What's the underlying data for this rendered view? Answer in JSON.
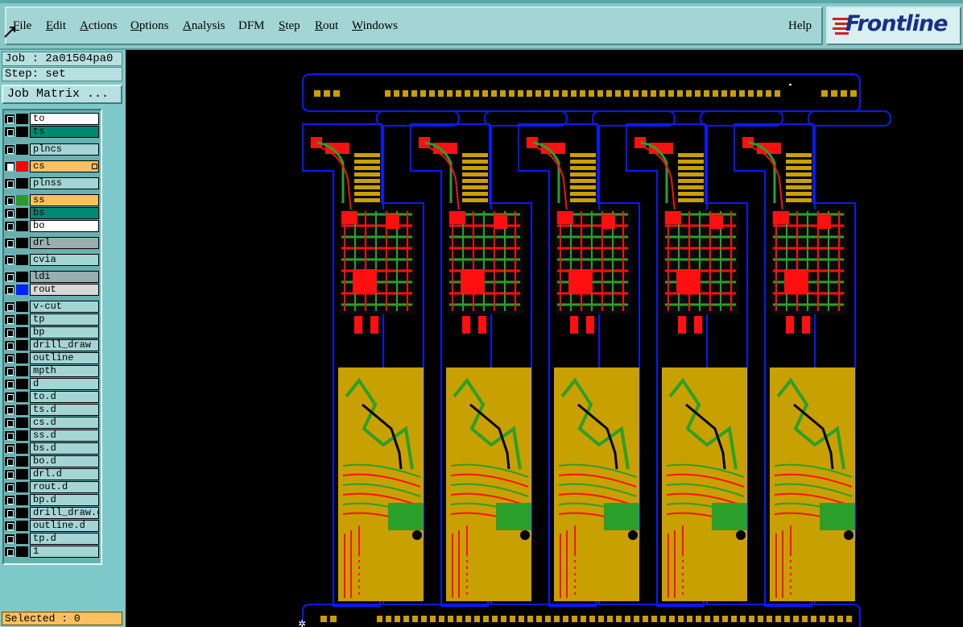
{
  "menubar": {
    "items": [
      {
        "label": "File"
      },
      {
        "label": "Edit"
      },
      {
        "label": "Actions"
      },
      {
        "label": "Options"
      },
      {
        "label": "Analysis"
      },
      {
        "label": "DFM"
      },
      {
        "label": "Step"
      },
      {
        "label": "Rout"
      },
      {
        "label": "Windows"
      }
    ],
    "help_label": "Help",
    "logo_text": "Frontline"
  },
  "job_info": {
    "job_line": "Job : 2a01504pa0",
    "step_line": "Step: set",
    "job_matrix_label": "Job Matrix ..."
  },
  "layers": [
    {
      "name": "to",
      "bg": "#ffffff",
      "swatch": "#000000"
    },
    {
      "name": "ts",
      "bg": "#008870",
      "swatch": "#000000"
    },
    {
      "name": "plncs",
      "bg": "#a3d5d5",
      "swatch": "#000000"
    },
    {
      "name": "cs",
      "bg": "#f8c060",
      "swatch": "#ff0000",
      "checked": true,
      "mark": true
    },
    {
      "name": "plnss",
      "bg": "#a3d5d5",
      "swatch": "#000000"
    },
    {
      "name": "ss",
      "bg": "#f8c060",
      "swatch": "#2a9a2a"
    },
    {
      "name": "bs",
      "bg": "#008870",
      "swatch": "#000000"
    },
    {
      "name": "bo",
      "bg": "#ffffff",
      "swatch": "#000000"
    },
    {
      "name": "drl",
      "bg": "#9aaeb0",
      "swatch": "#000000"
    },
    {
      "name": "cvia",
      "bg": "#a3d5d5",
      "swatch": "#000000"
    },
    {
      "name": "ldi",
      "bg": "#9aaeb0",
      "swatch": "#000000"
    },
    {
      "name": "rout",
      "bg": "#d8d8d8",
      "swatch": "#0022ff"
    },
    {
      "name": "v-cut",
      "bg": "#a3d5d5",
      "swatch": "#000000"
    },
    {
      "name": "tp",
      "bg": "#a3d5d5",
      "swatch": "#000000"
    },
    {
      "name": "bp",
      "bg": "#a3d5d5",
      "swatch": "#000000"
    },
    {
      "name": "drill_draw",
      "bg": "#a3d5d5",
      "swatch": "#000000"
    },
    {
      "name": "outline",
      "bg": "#a3d5d5",
      "swatch": "#000000"
    },
    {
      "name": "mpth",
      "bg": "#a3d5d5",
      "swatch": "#000000"
    },
    {
      "name": "d",
      "bg": "#a3d5d5",
      "swatch": "#000000"
    },
    {
      "name": "to.d",
      "bg": "#a3d5d5",
      "swatch": "#000000"
    },
    {
      "name": "ts.d",
      "bg": "#a3d5d5",
      "swatch": "#000000"
    },
    {
      "name": "cs.d",
      "bg": "#a3d5d5",
      "swatch": "#000000"
    },
    {
      "name": "ss.d",
      "bg": "#a3d5d5",
      "swatch": "#000000"
    },
    {
      "name": "bs.d",
      "bg": "#a3d5d5",
      "swatch": "#000000"
    },
    {
      "name": "bo.d",
      "bg": "#a3d5d5",
      "swatch": "#000000"
    },
    {
      "name": "drl.d",
      "bg": "#a3d5d5",
      "swatch": "#000000"
    },
    {
      "name": "rout.d",
      "bg": "#a3d5d5",
      "swatch": "#000000"
    },
    {
      "name": "bp.d",
      "bg": "#a3d5d5",
      "swatch": "#000000"
    },
    {
      "name": "drill_draw.d",
      "bg": "#a3d5d5",
      "swatch": "#000000"
    },
    {
      "name": "outline.d",
      "bg": "#a3d5d5",
      "swatch": "#000000"
    },
    {
      "name": "tp.d",
      "bg": "#a3d5d5",
      "swatch": "#000000"
    },
    {
      "name": "1",
      "bg": "#a3d5d5",
      "swatch": "#000000"
    }
  ],
  "status": {
    "selected_text": "Selected : 0"
  },
  "colors": {
    "copper_top": "#ff1010",
    "copper_bottom": "#2aa02a",
    "pads": "#c8a000",
    "rout_outline": "#0a1aff",
    "background": "#000000"
  },
  "icons": [
    "arrow-cursor-icon",
    "frontline-logo-icon"
  ]
}
